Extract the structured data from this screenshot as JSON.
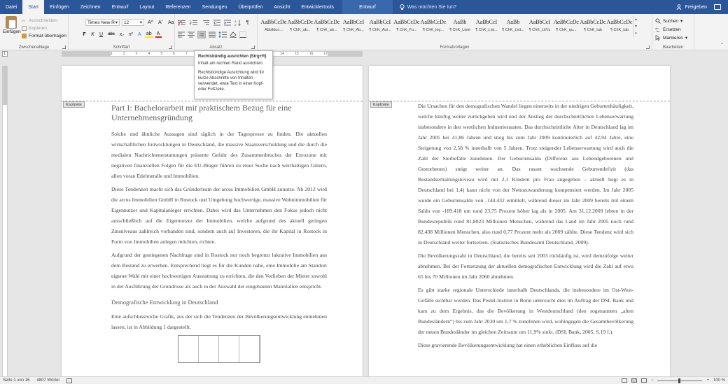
{
  "tabs": {
    "items": [
      "Datei",
      "Start",
      "Einfügen",
      "Zeichnen",
      "Entwurf",
      "Layout",
      "Referenzen",
      "Sendungen",
      "Überprüfen",
      "Ansicht",
      "Entwicklertools"
    ],
    "active_index": 1,
    "context_tab": "Entwurf",
    "tell_me": "Was möchten Sie tun?",
    "share": "Freigeben"
  },
  "clipboard": {
    "paste": "Einfügen",
    "cut": "Ausschneiden",
    "copy": "Kopieren",
    "format_painter": "Format übertragen",
    "label": "Zwischenablage"
  },
  "font": {
    "name": "Times New R",
    "size": "12",
    "label": "Schriftart",
    "bold": "F",
    "italic": "K",
    "underline": "U",
    "strike": "abc",
    "sub": "x₂",
    "sup": "x²",
    "grow": "A^",
    "shrink": "Aˇ",
    "case": "Aa",
    "clear": "A",
    "effects": "A",
    "highlight": "ab",
    "color": "A"
  },
  "paragraph": {
    "label": "Absatz"
  },
  "styles": {
    "label": "Formatvorlagen",
    "items": [
      {
        "preview": "AaBbCcDc",
        "name": "Abbildun..."
      },
      {
        "preview": "AaBbCcDc",
        "name": "¶ ChK_ab..."
      },
      {
        "preview": "AaBbCcDc",
        "name": "¶ ChK_ab..."
      },
      {
        "preview": "AaBbCcI",
        "name": "¶ ChK_Ab..."
      },
      {
        "preview": "AaBbCcI",
        "name": "¶ ChK_Aut..."
      },
      {
        "preview": "AaBbCcDc",
        "name": "¶ ChK_Fu..."
      },
      {
        "preview": "AaBbCcDc",
        "name": "¶ ChK_leg..."
      },
      {
        "preview": "AaBb",
        "name": "¶ ChK_Liste"
      },
      {
        "preview": "AaBbCcI",
        "name": "¶ ChK_List..."
      },
      {
        "preview": "AaBb",
        "name": "¶ ChK_List..."
      },
      {
        "preview": "AaBbCcI",
        "name": "¶ ChK_LitVz"
      },
      {
        "preview": "AaBbCcDc",
        "name": "¶ ChK_qu..."
      },
      {
        "preview": "AaBbCcDc",
        "name": "¶ ChK_tab"
      },
      {
        "preview": "AaBbCcDc",
        "name": "¶ ChK_tab"
      }
    ]
  },
  "editing": {
    "label": "Bearbeiten",
    "find": "Suchen",
    "replace": "Ersetzen",
    "select": "Markieren"
  },
  "ruler": {
    "ticks": [
      "1",
      "2",
      "3",
      "4",
      "5",
      "6",
      "7",
      "8",
      "9",
      "10",
      "11",
      "12",
      "13",
      "14",
      "15",
      "16",
      "17"
    ]
  },
  "tooltip": {
    "title": "Rechtsbündig ausrichten (Strg+R)",
    "line1": "Inhalt am rechten Rand ausrichten.",
    "line2": "Rechtsbündige Ausrichtung wird für kurze Abschnitte von Inhalten verwendet, etwa Text in einer Kopf- oder Fußzeile."
  },
  "page_left": {
    "header_tag": "Kopfzeile",
    "title": "Part I: Bachelorarbeit mit praktischem Bezug für eine Unternehmensgründung",
    "paragraphs": [
      "Solche und ähnliche Aussagen sind täglich in der Tagespresse zu finden. Die aktuellen wirtschaftlichen Entwicklungen in Deutschland, die massive Staatsverschuldung und die durch die medialen Nachrichtenerstattungen präsente Gefahr des Zusammenbruches der Eurozone mit negativen finanziellen Folgen für die EU-Bürger führen zu einer Suche nach werthaltigen Gütern, allen voran Edelmetalle und Immobilien.",
      "Diese Tendenzen macht sich das Gründerteam der arcus Immobilien GmbH zunutze. Ab 2012 wird die arcus Immobilien GmbH in Rostock und Umgebung hochwertige, massive Wohnimmobilien für Eigennutzer und Kapitalanleger errichten. Dabei wird das Unternehmen den Fokus jedoch nicht ausschließlich auf die Eigennutzer der Immobilien, welche aufgrund des aktuell geringen Zinsniveaus zahlreich vorhanden sind, sondern auch auf Investoren, die ihr Kapital in Rostock in Form von Immobilien anlegen möchten, richten.",
      "Aufgrund der gestiegenen Nachfrage sind in Rostock nur noch begrenzt lukrative Immobilien aus dem Bestand zu erwerben. Entsprechend liegt es für die Kunden nahe, eine Immobilie am Standort eigener Wahl mit einer hochwertigen Ausstattung zu errichten, die den Vorlieben der Mieter sowohl in der Ausführung der Grundrisse als auch in der Auswahl der eingebauten Materialien entspricht."
    ],
    "subheading": "Demografische Entwicklung in Deutschland",
    "last_paragraph": "Eine aufschlussreiche Grafik, aus der sich die Tendenzen der Bevölkerungsentwicklung entnehmen lassen, ist in Abbildung 1 dargestellt."
  },
  "page_right": {
    "header_tag": "Kopfzeile",
    "paragraphs": [
      "Die Ursachen für den demografischen Wandel liegen einerseits in der niedrigen Geburtenhäufigkeit, welche künftig weiter zurückgehen wird und der Anstieg der durchschnittlichen Lebenserwartung insbesondere in den westlichen Industriestaaten. Das durchschnittliche Alter in Deutschland lag im Jahr 2005 bei 41,86 Jahren und stieg bis zum Jahr 2009 kontinuierlich auf 42,94 Jahre, eine Steigerung von 2,58 % innerhalb von 5 Jahren. Trotz steigender Lebenserwartung wird auch die Zahl der Sterbefälle zunehmen. Der Geburtensaldo (Differenz aus Lebendgeborenen und Gestorbenen) steigt weiter an. Das rasant wachsende Geburtendefizit (das Bestandserhaltungsniveau wird mit 2,1 Kindern pro Frau angegeben – aktuell liegt es in Deutschland bei 1,4) kann nicht von der Nettozuwanderung kompensiert werden. Im Jahr 2005 wurde ein Geburtensaldo von -144.432 ermittelt, während dieser im Jahr 2009 bereits mit einem Saldo von -189.418 um rund 23,75 Prozent höher lag als in 2005. Am 31.12.2009 lebten in der Bundesrepublik rund 81,8023 Millionen Menschen, während das Land im Jahr 2005 noch rund 82,438 Millionen Menschen, also rund 0,77 Prozent mehr als 2009 zählte. Diese Tendenz wird sich in Deutschland weiter fortsetzen. (Statistisches Bundesamt Deutschland, 2009).",
      "Die Bevölkerungszahl in Deutschland, die bereits seit 2003 rückläufig ist, wird demzufolge weiter abnehmen. Bei der Fortsetzung der aktuellen demografischen Entwicklung wird die Zahl auf etwa 65 bis 70 Millionen im Jahr 2060 abnehmen.",
      "Es gibt starke regionale Unterschiede innerhalb Deutschlands, die insbesondere im Ost-West-Gefälle sichtbar werden. Das Pestel-Institut in Bonn untersucht dies im Auftrag der DSL Bank und kam zu dem Ergebnis, das die Bevölkerung in Westdeutschland (den sogenannten „alten Bundesländern“) bis zum Jahr 2030 um 1,7 % zunehmen wird, wohingegen die Gesamtbevölkerung der neuen Bundesländer im gleichen Zeitraum um 11,9% sinkt. (DSL Bank, 2005, S.19 f.).",
      "Diese gravierende Bevölkerungsentwicklung hat einen erheblichen Einfluss auf die"
    ]
  },
  "status": {
    "page": "Seite 1 von 16",
    "words": "4807 Wörter",
    "zoom": "100 %"
  },
  "colors": {
    "accent": "#2b579a"
  }
}
